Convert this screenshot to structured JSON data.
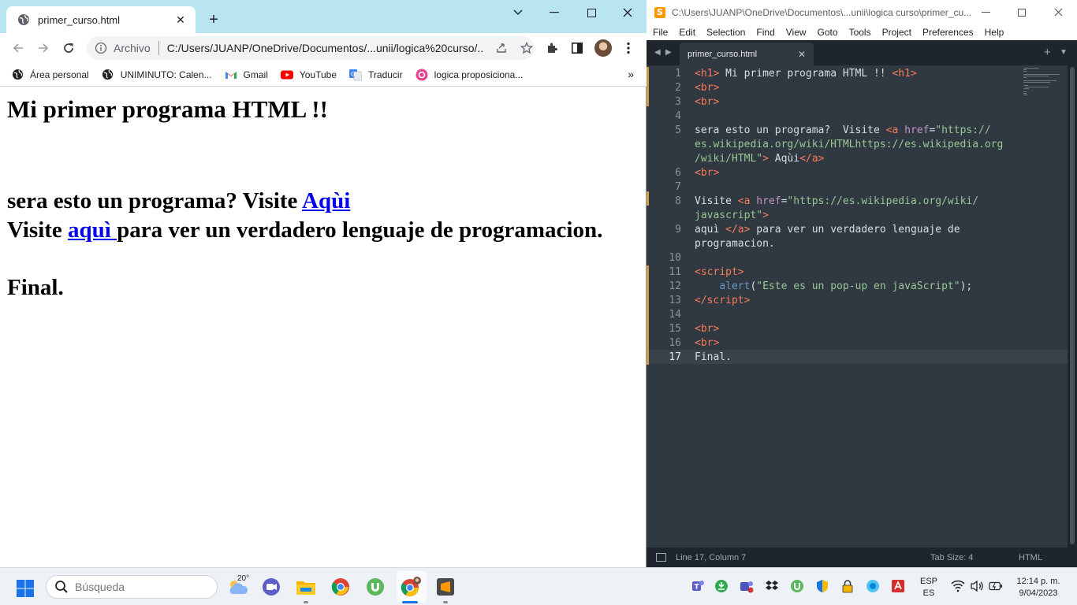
{
  "chrome": {
    "tab_title": "primer_curso.html",
    "security_label": "Archivo",
    "url": "C:/Users/JUANP/OneDrive/Documentos/...unii/logica%20curso/...",
    "bookmarks": [
      {
        "label": "Área personal",
        "icon": "globe-icon"
      },
      {
        "label": "UNIMINUTO: Calen...",
        "icon": "globe-icon"
      },
      {
        "label": "Gmail",
        "icon": "gmail-icon"
      },
      {
        "label": "YouTube",
        "icon": "youtube-icon"
      },
      {
        "label": "Traducir",
        "icon": "translate-icon"
      },
      {
        "label": "logica proposiciona...",
        "icon": "pink-app-icon"
      }
    ],
    "page": {
      "heading": "Mi primer programa HTML !!",
      "line1_text": "sera esto un programa? Visite ",
      "line1_link": "Aqùi",
      "line2_text_before": "Visite ",
      "line2_link": "aquì ",
      "line2_text_after": "para ver un verdadero lenguaje de programacion.",
      "final": "Final."
    }
  },
  "sublime": {
    "title": "C:\\Users\\JUANP\\OneDrive\\Documentos\\...unii\\logica curso\\primer_cu...",
    "menu": [
      "File",
      "Edit",
      "Selection",
      "Find",
      "View",
      "Goto",
      "Tools",
      "Project",
      "Preferences",
      "Help"
    ],
    "tab_title": "primer_curso.html",
    "line_numbers": [
      "1",
      "2",
      "3",
      "4",
      "5",
      "6",
      "7",
      "8",
      "9",
      "10",
      "11",
      "12",
      "13",
      "14",
      "15",
      "16",
      "17"
    ],
    "code": {
      "l1": [
        "<",
        "h1",
        ">",
        " Mi primer programa HTML !! ",
        "<",
        "h1",
        ">"
      ],
      "l2": [
        "<",
        "br",
        ">"
      ],
      "l3": [
        "<",
        "br",
        ">"
      ],
      "l5a": [
        "sera esto un programa?  Visite ",
        "<",
        "a",
        " ",
        "href",
        "=",
        "\"https://"
      ],
      "l5b": "es.wikipedia.org/wiki/HTMLhttps://es.wikipedia.org",
      "l5c": [
        "/wiki/HTML\"",
        ">",
        " Aqùi",
        "</",
        "a",
        ">"
      ],
      "l6": [
        "<",
        "br",
        ">"
      ],
      "l8a": [
        "Visite ",
        "<",
        "a",
        " ",
        "href",
        "=",
        "\"https://es.wikipedia.org/wiki/"
      ],
      "l8b": [
        "javascript\"",
        ">"
      ],
      "l9a": [
        "aquì ",
        "</",
        "a",
        ">",
        " para ver un verdadero lenguaje de"
      ],
      "l9b": "programacion.",
      "l11": [
        "<",
        "script",
        ">"
      ],
      "l12": [
        "    ",
        "alert",
        "(",
        "\"Este es un pop-up en javaScript\"",
        ");"
      ],
      "l13": [
        "</",
        "script",
        ">"
      ],
      "l15": [
        "<",
        "br",
        ">"
      ],
      "l16": [
        "<",
        "br",
        ">"
      ],
      "l17": "Final."
    },
    "status": {
      "position": "Line 17, Column 7",
      "tab_size": "Tab Size: 4",
      "syntax": "HTML"
    }
  },
  "taskbar": {
    "search_placeholder": "Búsqueda",
    "weather_temp": "20°",
    "lang_top": "ESP",
    "lang_bottom": "ES",
    "time": "12:14 p. m.",
    "date": "9/04/2023"
  },
  "colors": {
    "chrome_titlebar": "#b9e5f0",
    "link": "#0000ee",
    "editor_bg": "#303841",
    "tag": "#f97b58",
    "attr": "#c695c6",
    "string": "#99c794"
  }
}
